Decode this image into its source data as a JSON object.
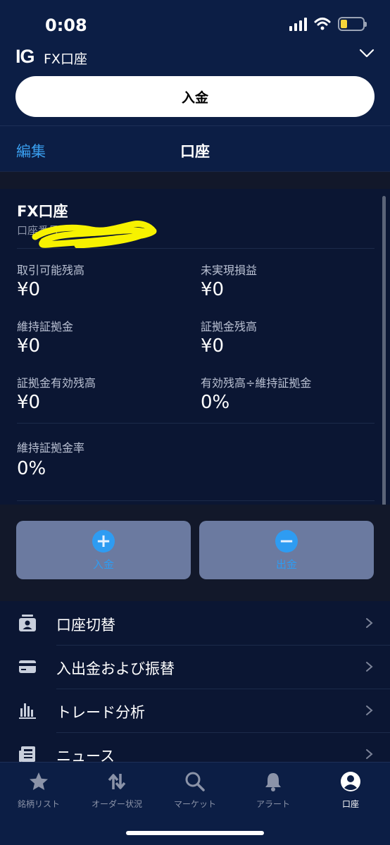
{
  "status": {
    "time": "0:08"
  },
  "header": {
    "logo": "IG",
    "account_name": "FX口座",
    "deposit_button": "入金"
  },
  "nav": {
    "edit": "編集",
    "title": "口座"
  },
  "account": {
    "name": "FX口座",
    "number_label": "口座番号",
    "metrics": [
      {
        "label": "取引可能残高",
        "value": "¥0"
      },
      {
        "label": "未実現損益",
        "value": "¥0"
      },
      {
        "label": "維持証拠金",
        "value": "¥0"
      },
      {
        "label": "証拠金残高",
        "value": "¥0"
      },
      {
        "label": "証拠金有効残高",
        "value": "¥0"
      },
      {
        "label": "有効残高÷維持証拠金",
        "value": "0%"
      }
    ],
    "margin_rate": {
      "label": "維持証拠金率",
      "value": "0%"
    }
  },
  "actions": {
    "deposit": "入金",
    "withdraw": "出金"
  },
  "menu": [
    {
      "label": "口座切替",
      "icon": "account-switch-icon"
    },
    {
      "label": "入出金および振替",
      "icon": "card-icon"
    },
    {
      "label": "トレード分析",
      "icon": "bar-chart-icon"
    },
    {
      "label": "ニュース",
      "icon": "news-icon"
    }
  ],
  "tabs": [
    {
      "label": "銘柄リスト",
      "icon": "star-icon"
    },
    {
      "label": "オーダー状況",
      "icon": "arrows-icon"
    },
    {
      "label": "マーケット",
      "icon": "search-icon"
    },
    {
      "label": "アラート",
      "icon": "bell-icon"
    },
    {
      "label": "口座",
      "icon": "profile-icon",
      "active": true
    }
  ],
  "colors": {
    "accent": "#3aa0f1",
    "background": "#0b1633",
    "header": "#0c1e45",
    "action_button": "#6b7aa0"
  }
}
